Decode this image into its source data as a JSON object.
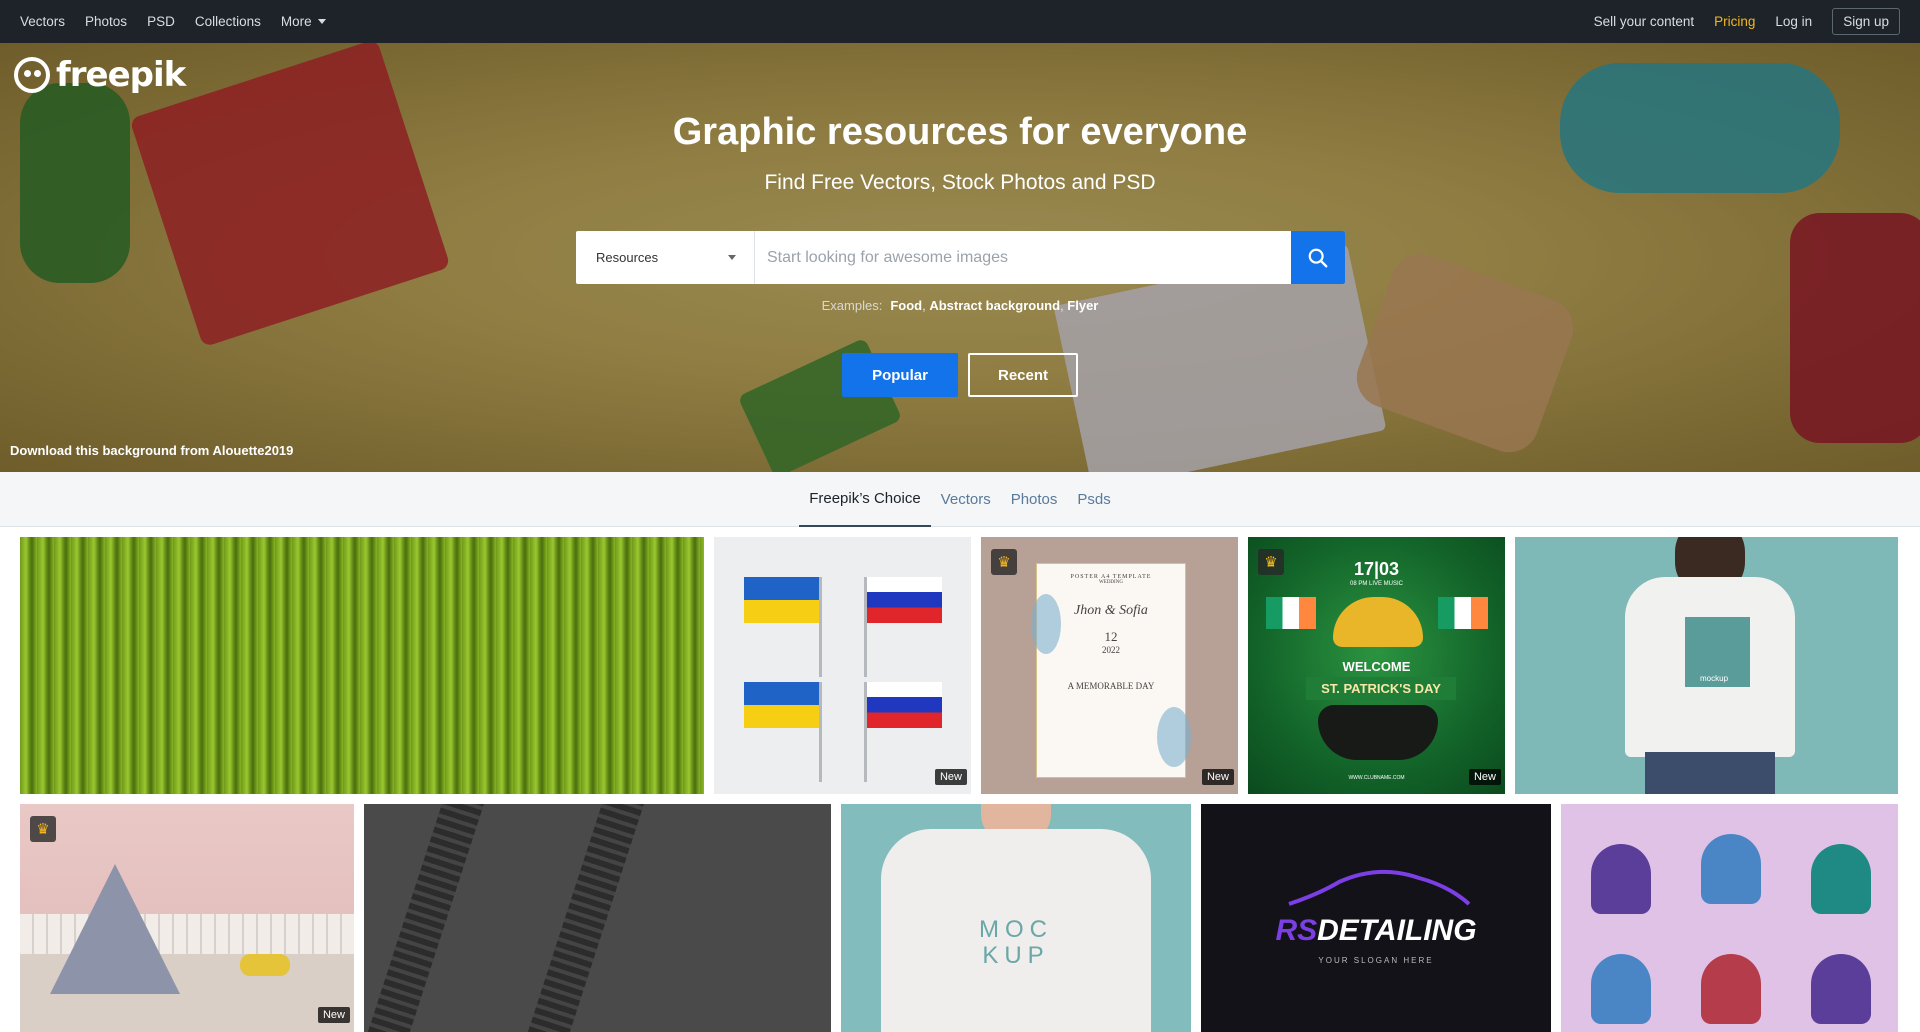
{
  "nav": {
    "left": [
      {
        "label": "Vectors"
      },
      {
        "label": "Photos"
      },
      {
        "label": "PSD"
      },
      {
        "label": "Collections"
      },
      {
        "label": "More"
      }
    ],
    "sell": "Sell your content",
    "pricing": "Pricing",
    "login": "Log in",
    "signup": "Sign up"
  },
  "hero": {
    "logo": "freepik",
    "title": "Graphic resources for everyone",
    "subtitle": "Find Free Vectors, Stock Photos and PSD",
    "search": {
      "category": "Resources",
      "placeholder": "Start looking for awesome images"
    },
    "examples_label": "Examples:",
    "examples": [
      "Food",
      "Abstract background",
      "Flyer"
    ],
    "btn_popular": "Popular",
    "btn_recent": "Recent",
    "credit": "Download this background from Alouette2019"
  },
  "tabs": [
    {
      "label": "Freepik’s Choice",
      "active": true
    },
    {
      "label": "Vectors"
    },
    {
      "label": "Photos"
    },
    {
      "label": "Psds"
    }
  ],
  "tiles": {
    "new_badge": "New",
    "poster_a": "POSTER A4 TEMPLATE",
    "poster_b": "WEDDING",
    "poster_names": "Jhon & Sofia",
    "poster_date": "12",
    "poster_year": "2022",
    "poster_tag": "A MEMORABLE DAY",
    "patrick_date": "17|03",
    "patrick_sub": "08 PM LIVE MUSIC",
    "patrick_welcome": "WELCOME",
    "patrick_title": "ST. PATRICK'S DAY",
    "patrick_url": "WWW.CLUBNAME.COM",
    "mockup_small": "mockup",
    "mockup_line1": "MOC",
    "mockup_line2": "KUP",
    "rs_logo_a": "RS",
    "rs_logo_b": "DETAILING",
    "rs_slogan": "YOUR SLOGAN HERE"
  },
  "colors": {
    "accent": "#1273eb",
    "pricing": "#f4b71b",
    "topbar": "#1d2329"
  }
}
